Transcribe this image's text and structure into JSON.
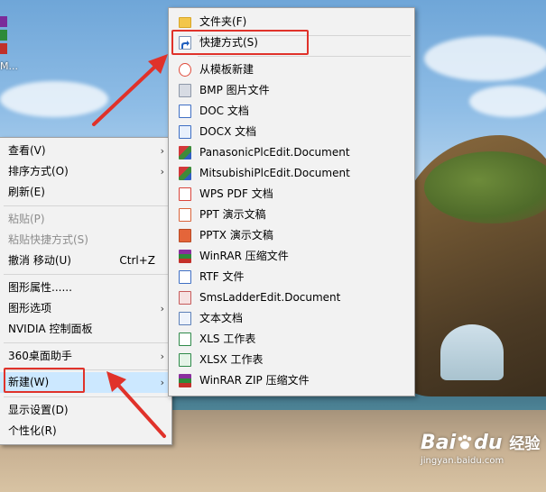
{
  "desktop": {
    "icon_label": "M..."
  },
  "context_menu": {
    "items": [
      {
        "label": "查看(V)",
        "submenu": true
      },
      {
        "label": "排序方式(O)",
        "submenu": true
      },
      {
        "label": "刷新(E)"
      },
      {
        "label": "粘贴(P)",
        "disabled": true
      },
      {
        "label": "粘贴快捷方式(S)",
        "disabled": true
      },
      {
        "label": "撤消 移动(U)",
        "shortcut": "Ctrl+Z"
      },
      {
        "label": "图形属性......"
      },
      {
        "label": "图形选项",
        "submenu": true
      },
      {
        "label": "NVIDIA 控制面板"
      },
      {
        "label": "360桌面助手",
        "submenu": true
      },
      {
        "label": "新建(W)",
        "submenu": true,
        "highlighted": true
      },
      {
        "label": "显示设置(D)"
      },
      {
        "label": "个性化(R)"
      }
    ],
    "arrow_glyph": "›"
  },
  "new_submenu": {
    "items": [
      {
        "label": "文件夹(F)",
        "icon": "folder-icon"
      },
      {
        "label": "快捷方式(S)",
        "icon": "shortcut-icon",
        "highlighted": true
      },
      {
        "label": "从模板新建",
        "icon": "template-icon"
      },
      {
        "label": "BMP 图片文件",
        "icon": "bmp-file-icon"
      },
      {
        "label": "DOC 文档",
        "icon": "doc-file-icon"
      },
      {
        "label": "DOCX 文档",
        "icon": "docx-file-icon"
      },
      {
        "label": "PanasonicPlcEdit.Document",
        "icon": "panasonic-plc-icon"
      },
      {
        "label": "MitsubishiPlcEdit.Document",
        "icon": "mitsubishi-plc-icon"
      },
      {
        "label": "WPS PDF 文档",
        "icon": "pdf-file-icon"
      },
      {
        "label": "PPT 演示文稿",
        "icon": "ppt-file-icon"
      },
      {
        "label": "PPTX 演示文稿",
        "icon": "pptx-file-icon"
      },
      {
        "label": "WinRAR 压缩文件",
        "icon": "winrar-icon"
      },
      {
        "label": "RTF 文件",
        "icon": "rtf-file-icon"
      },
      {
        "label": "SmsLadderEdit.Document",
        "icon": "sms-ladder-icon"
      },
      {
        "label": "文本文档",
        "icon": "text-file-icon"
      },
      {
        "label": "XLS 工作表",
        "icon": "xls-file-icon"
      },
      {
        "label": "XLSX 工作表",
        "icon": "xlsx-file-icon"
      },
      {
        "label": "WinRAR ZIP 压缩文件",
        "icon": "winrar-zip-icon"
      }
    ]
  },
  "watermark": {
    "brand": "Bai",
    "brand_suffix": "du",
    "jingyan": "经验",
    "url": "jingyan.baidu.com"
  },
  "colors": {
    "annotation_red": "#e0322a",
    "menu_bg": "#f2f2f2",
    "disabled_text": "#8d8d8d"
  }
}
